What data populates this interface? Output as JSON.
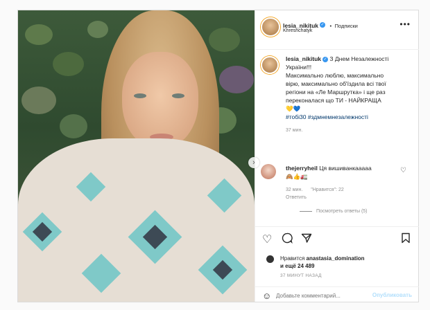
{
  "post": {
    "username": "lesia_nikituk",
    "follow_label": "Подписки",
    "location": "Khreshchatyk",
    "caption_line1": "З Днем Незалежності",
    "caption_line2": "України!!!",
    "caption_line3": "Максимально люблю, максимально",
    "caption_line4": "вірю, максимально об'їздила всі твої",
    "caption_line5": "регіони на «Ле Маршрутка» і ще раз",
    "caption_line6": "переконалася що ТИ - НАЙКРАЩА",
    "caption_emoji": "💛💙",
    "hashtags": "#тобі30 #здмнемнезалежності",
    "caption_time": "37 мин.",
    "comment": {
      "username": "thejerryheil",
      "text": "Ця вишиванкааааа",
      "emoji": "🙈👍🚛",
      "time": "32 мин.",
      "likes": "\"Нравится\": 22",
      "reply": "Ответить",
      "view_replies": "Посмотреть ответы (5)"
    },
    "likes_line1_prefix": "Нравится",
    "likes_user": "anastasia_domination",
    "likes_line2": "и ещё 24 489",
    "post_time": "37 МИНУТ НАЗАД",
    "comment_placeholder": "Добавьте комментарий...",
    "publish_label": "Опубликовать"
  },
  "icons": {
    "heart": "heart-icon",
    "comment": "comment-icon",
    "share": "share-icon",
    "save": "bookmark-icon",
    "more": "more-icon",
    "emoji": "emoji-icon",
    "next": "chevron-right-icon"
  }
}
